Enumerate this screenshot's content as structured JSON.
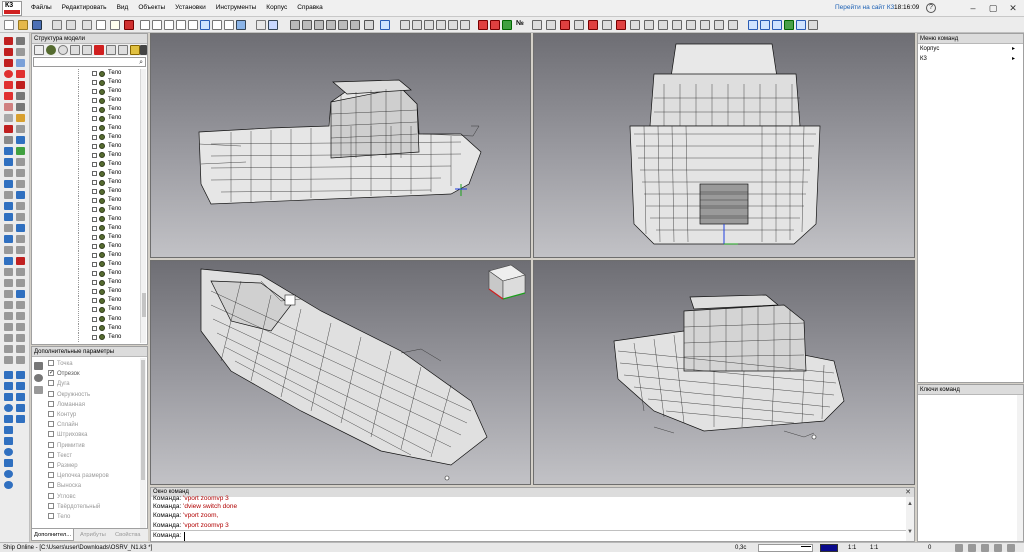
{
  "app": {
    "logo_text": "К3",
    "menu": [
      "Файлы",
      "Редактировать",
      "Вид",
      "Объекты",
      "Установки",
      "Инструменты",
      "Корпус",
      "Справка"
    ],
    "site_link": "Перейти на сайт К3",
    "clock": "18:16:09",
    "help": "?",
    "minimize": "–",
    "maximize": "▢",
    "close": "✕"
  },
  "toolbar": {
    "number_sign": "№"
  },
  "model_tree": {
    "title": "Структура модели",
    "search_placeholder": "",
    "items": [
      "Тело",
      "Тело",
      "Тело",
      "Тело",
      "Тело",
      "Тело",
      "Тело",
      "Тело",
      "Тело",
      "Тело",
      "Тело",
      "Тело",
      "Тело",
      "Тело",
      "Тело",
      "Тело",
      "Тело",
      "Тело",
      "Тело",
      "Тело",
      "Тело",
      "Тело",
      "Тело",
      "Тело",
      "Тело",
      "Тело",
      "Тело",
      "Тело",
      "Тело",
      "Тело"
    ]
  },
  "extra_params": {
    "title": "Дополнительные параметры",
    "items": [
      {
        "label": "Точка",
        "checked": false
      },
      {
        "label": "Отрезок",
        "checked": true
      },
      {
        "label": "Дуга",
        "checked": false
      },
      {
        "label": "Окружность",
        "checked": false
      },
      {
        "label": "Ломанная",
        "checked": false
      },
      {
        "label": "Контур",
        "checked": false
      },
      {
        "label": "Сплайн",
        "checked": false
      },
      {
        "label": "Штриховка",
        "checked": false
      },
      {
        "label": "Примитив",
        "checked": false
      },
      {
        "label": "Текст",
        "checked": false
      },
      {
        "label": "Размер",
        "checked": false
      },
      {
        "label": "Цепочка размеров",
        "checked": false
      },
      {
        "label": "Выноска",
        "checked": false
      },
      {
        "label": "Угловс",
        "checked": false
      },
      {
        "label": "Твёрдотельный",
        "checked": false
      },
      {
        "label": "Тело",
        "checked": false
      }
    ],
    "tabs": [
      "Дополнител...",
      "Атрибуты",
      "Свойства"
    ]
  },
  "command_window": {
    "title": "Окно команд",
    "close": "✕",
    "lines": [
      {
        "label": "Команда:",
        "value": "'vport zoomvp 3"
      },
      {
        "label": "Команда:",
        "value": "'dview switch done"
      },
      {
        "label": "Команда:",
        "value": "'vport zoom,"
      },
      {
        "label": "Команда:",
        "value": "'vport zoomvp 3"
      }
    ],
    "prompt": "Команда:",
    "input_value": "",
    "scroll_up": "▲",
    "scroll_down": "▼"
  },
  "right_panels": {
    "menu_title": "Меню команд",
    "menu_items": [
      "Корпус",
      "К3"
    ],
    "keys_title": "Ключи команд"
  },
  "status_bar": {
    "app_text": "Ship Online - [C:\\Users\\user\\Downloads\\OSRV_N1.k3 *]",
    "scale": "0,3c",
    "ratio1": "1:1",
    "ratio2": "1:1",
    "coord": "0"
  },
  "colors": {
    "accent_red": "#c00000",
    "command_value": "#b00000",
    "link_blue": "#1a5fb4",
    "status_color": "#0a0a8c"
  }
}
